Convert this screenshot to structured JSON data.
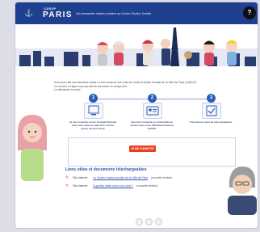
{
  "header": {
    "org_small": "CASVP",
    "city": "PARIS",
    "title": "Vos demandes d'aides sociales au Centre d'Action Sociale",
    "help_label": "?"
  },
  "intro": {
    "line1": "Vous avez fait une demande d'aide ou bien recevez une aide du Centre d'Action Sociale de la Ville de Paris (CASVP).",
    "line2": "Ce service en ligne vous permet de les suivre en temps réel.",
    "line3": "La démarche à suivre :"
  },
  "steps": [
    {
      "num": "1",
      "text": "Je me connecte à mon Compte Parisien avec mon adresse mail et le mot de passe de mon choix"
    },
    {
      "num": "2",
      "text": "Une fois connecté, je m'identifie au service avec mon identifiant internet CASVP"
    },
    {
      "num": "3",
      "text": "J'accède au suivi de mes demandes"
    }
  ],
  "cta_label": "JE ME CONNECTE",
  "links": {
    "title": "Liens utiles et documents téléchargeables",
    "items": [
      {
        "kind": "Site internet",
        "link": "Le Centre d'action sociale de la Ville de Paris",
        "note": "(nouvelle fenêtre)"
      },
      {
        "kind": "Site internet",
        "link": "À quelles aides avez-vous droit ?",
        "note": "(nouvelle fenêtre)"
      }
    ]
  },
  "colors": {
    "header_bg": "#1f3f8f",
    "accent_blue": "#2c5db8",
    "cta_orange": "#e8401d"
  },
  "icons": {
    "logo": "paris-ship-icon",
    "help": "help-icon",
    "step1": "login-screen-icon",
    "step2": "id-card-icon",
    "step3": "tracking-icon",
    "link": "external-link-icon"
  }
}
